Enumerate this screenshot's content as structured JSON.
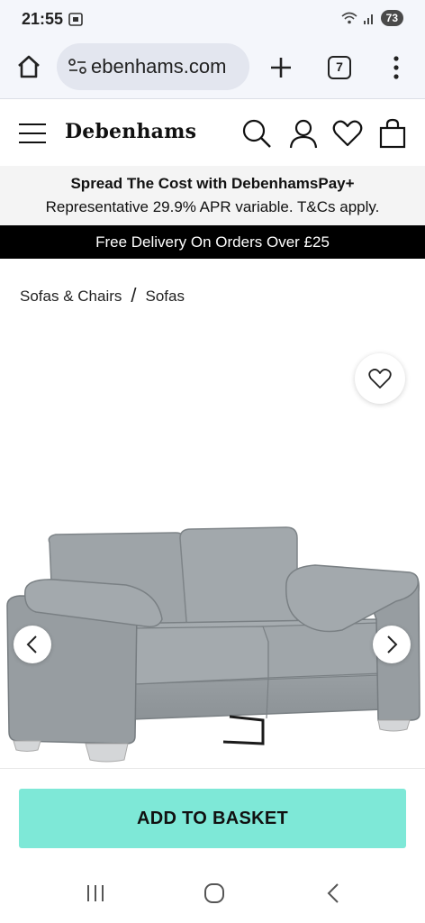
{
  "status_bar": {
    "time": "21:55",
    "battery": "73",
    "icons": [
      "screenshot-icon",
      "wifi-icon",
      "signal-icon",
      "battery-icon"
    ]
  },
  "browser": {
    "url": "ebenhams.com",
    "tab_count": "7",
    "icons": [
      "home-icon",
      "site-settings-icon",
      "new-tab-icon",
      "tabs-icon",
      "more-vert-icon"
    ]
  },
  "header": {
    "logo": "Debenhams",
    "icons": [
      "menu-icon",
      "search-icon",
      "account-icon",
      "wishlist-icon",
      "bag-icon"
    ]
  },
  "promo": {
    "title": "Spread The Cost with DebenhamsPay+",
    "subtitle": "Representative 29.9% APR variable. T&Cs apply."
  },
  "delivery_banner": "Free Delivery On Orders Over £25",
  "breadcrumb": {
    "items": [
      "Sofas & Chairs",
      "Sofas"
    ],
    "separator": "/"
  },
  "product": {
    "image_icons": [
      "wishlist-heart-icon",
      "chevron-left-icon",
      "chevron-right-icon"
    ],
    "colors": {
      "sofa": "#9aa0a4",
      "accent_button": "#7ee8d7"
    }
  },
  "basket": {
    "button_label": "ADD TO BASKET"
  },
  "android_nav": {
    "icons": [
      "recents-icon",
      "home-circle-icon",
      "back-icon"
    ]
  }
}
